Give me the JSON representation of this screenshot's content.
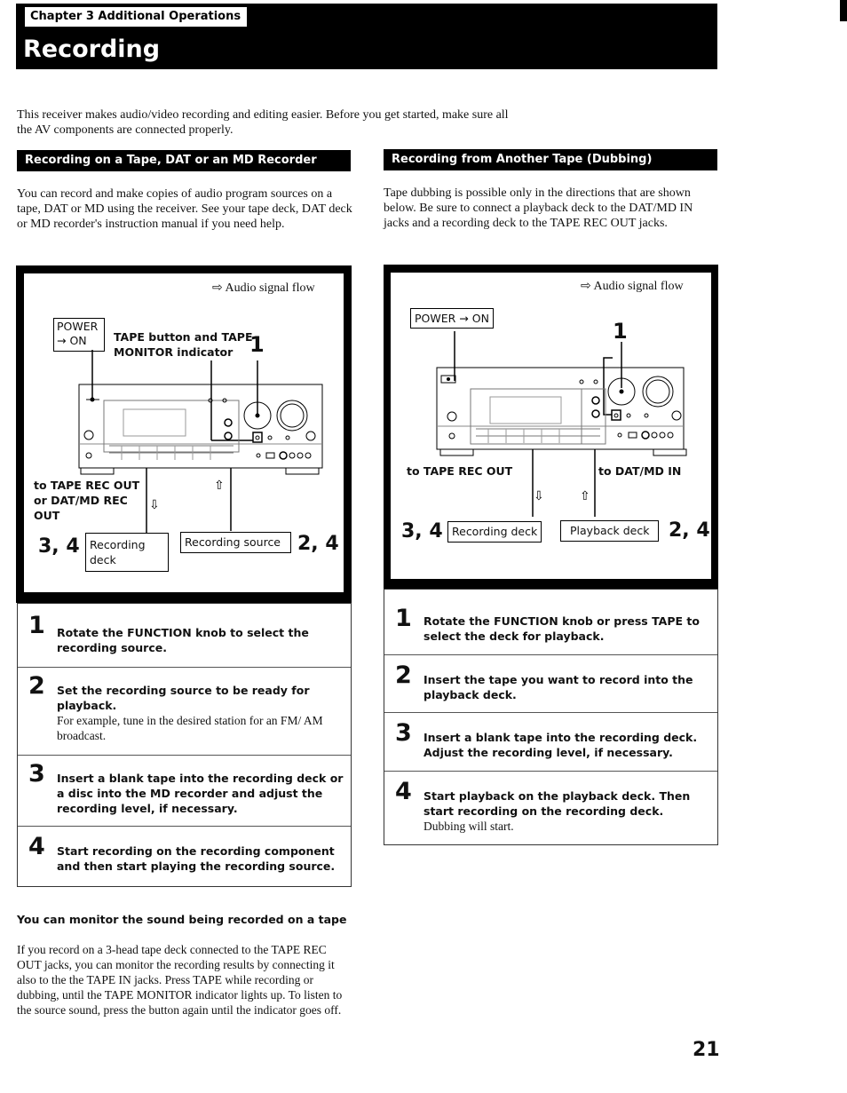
{
  "header": {
    "chapter": "Chapter 3 Additional Operations",
    "title": "Recording"
  },
  "intro": "This receiver makes audio/video recording and editing easier.  Before you get started, make sure all the AV components are connected properly.",
  "left": {
    "heading": "Recording on a Tape, DAT or an MD Recorder",
    "paragraph": "You can record and make copies of audio program sources on a tape, DAT or MD using the receiver.  See your tape deck, DAT deck or MD recorder's instruction manual if you need help.",
    "diagram": {
      "legend": "Audio signal flow",
      "legend_icon": "arrow-right-outline-icon",
      "power_box": [
        "POWER",
        "→ ON"
      ],
      "tape_label": [
        "TAPE button and TAPE",
        "MONITOR indicator"
      ],
      "callout_1": "1",
      "output_label": [
        "to TAPE REC OUT",
        "or DAT/MD REC",
        "OUT"
      ],
      "rec_deck_num": "3, 4",
      "rec_deck_label": [
        "Recording",
        "deck"
      ],
      "source_label": "Recording source",
      "source_num": "2, 4"
    },
    "steps": [
      {
        "num": "1",
        "title": "Rotate the FUNCTION knob to select the recording source.",
        "note": ""
      },
      {
        "num": "2",
        "title": "Set the recording source to be ready for playback.",
        "note": "For example, tune in the desired station for an FM/ AM broadcast."
      },
      {
        "num": "3",
        "title": "Insert a blank tape into the recording deck or a disc into the MD recorder and adjust the recording level, if necessary.",
        "note": ""
      },
      {
        "num": "4",
        "title": "Start recording on the recording component and then start playing the recording source.",
        "note": ""
      }
    ],
    "tip": {
      "title": "You can monitor the sound being recorded on a tape",
      "body": "If you record on a 3-head tape deck connected to the TAPE REC OUT jacks, you can monitor the recording results by connecting it also to the the TAPE IN jacks.  Press TAPE while recording or dubbing, until the TAPE MONITOR indicator lights up.  To listen to the source sound, press the button again until the indicator goes off."
    }
  },
  "right": {
    "heading": "Recording from Another Tape (Dubbing)",
    "paragraph": "Tape dubbing is possible only in the directions that are shown below.  Be sure to connect a playback deck to the DAT/MD IN jacks and a recording deck to the TAPE REC OUT jacks.",
    "diagram": {
      "legend": "Audio signal flow",
      "legend_icon": "arrow-right-outline-icon",
      "power_box": "POWER → ON",
      "callout_1": "1",
      "output_label": "to TAPE REC OUT",
      "input_label": "to DAT/MD IN",
      "rec_deck_num": "3, 4",
      "rec_deck_label": "Recording deck",
      "play_deck_label": "Playback deck",
      "play_deck_num": "2, 4"
    },
    "steps": [
      {
        "num": "1",
        "title": "Rotate the FUNCTION knob or press TAPE to select the deck for playback.",
        "note": ""
      },
      {
        "num": "2",
        "title": "Insert the tape you want to record into the playback deck.",
        "note": ""
      },
      {
        "num": "3",
        "title": "Insert a blank tape into the recording deck. Adjust the recording level, if necessary.",
        "note": ""
      },
      {
        "num": "4",
        "title": "Start playback on the playback deck.  Then start recording on the recording deck.",
        "note": "Dubbing will start."
      }
    ]
  },
  "page_number": "21"
}
